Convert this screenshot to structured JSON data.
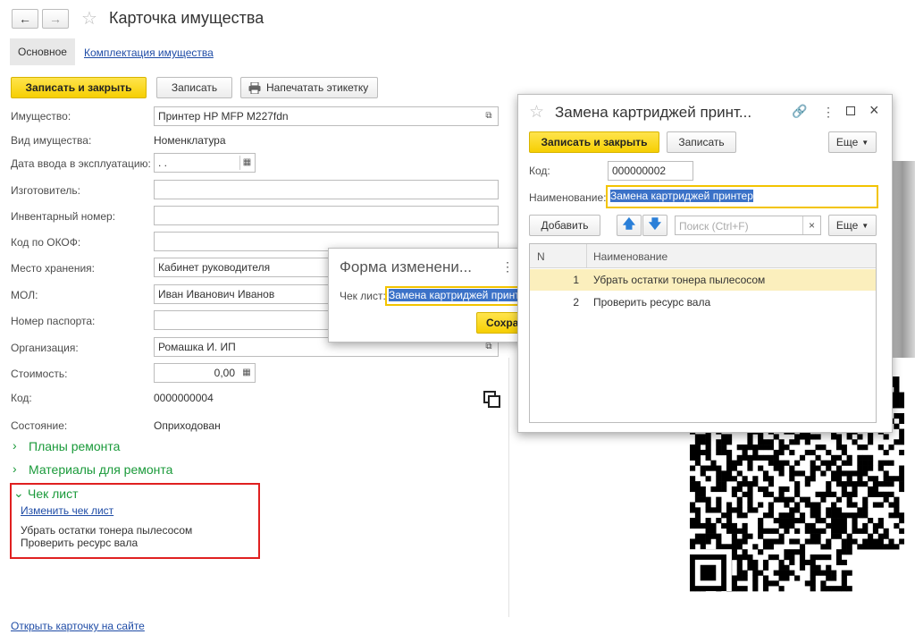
{
  "main": {
    "title": "Карточка имущества",
    "tabs": [
      {
        "label": "Основное"
      },
      {
        "label": "Комплектация имущества"
      }
    ],
    "toolbar": {
      "save_close": "Записать и закрыть",
      "save": "Записать",
      "print_label": "Напечатать этикетку"
    },
    "fields": {
      "property_label": "Имущество:",
      "property_value": "Принтер HP MFP M227fdn",
      "type_label": "Вид имущества:",
      "type_value": "Номенклатура",
      "date_label": "Дата ввода в эксплуатацию:",
      "date_value": " .  .",
      "manufacturer_label": "Изготовитель:",
      "manufacturer_value": "",
      "inventory_label": "Инвентарный номер:",
      "inventory_value": "",
      "okof_label": "Код по ОКОФ:",
      "okof_value": "",
      "storage_label": "Место хранения:",
      "storage_value": "Кабинет руководителя",
      "mol_label": "МОЛ:",
      "mol_value": "Иван Иванович Иванов",
      "passport_label": "Номер паспорта:",
      "passport_value": "",
      "org_label": "Организация:",
      "org_value": "Ромашка И. ИП",
      "cost_label": "Стоимость:",
      "cost_value": "0,00",
      "code_label": "Код:",
      "code_value": "0000000004",
      "state_label": "Состояние:",
      "state_value": "Оприходован"
    },
    "sections": {
      "repair_plans": "Планы ремонта",
      "repair_materials": "Материалы для ремонта",
      "checklist": "Чек лист",
      "change_checklist": "Изменить чек лист",
      "checklist_items": [
        "Убрать остатки тонера пылесосом",
        "Проверить ресурс вала"
      ]
    },
    "open_site": "Открыть карточку на сайте"
  },
  "change_form": {
    "title": "Форма изменени...",
    "checklist_label": "Чек лист:",
    "checklist_value": "Замена картриджей принтер",
    "save_button": "Сохра"
  },
  "dialog": {
    "title": "Замена картриджей принт...",
    "save_close": "Записать и закрыть",
    "save": "Записать",
    "more": "Еще",
    "code_label": "Код:",
    "code_value": "000000002",
    "name_label": "Наименование:",
    "name_value": "Замена картриджей принтер",
    "add_button": "Добавить",
    "search_placeholder": "Поиск (Ctrl+F)",
    "more2": "Еще",
    "table": {
      "headers": [
        "N",
        "Наименование"
      ],
      "rows": [
        {
          "n": "1",
          "name": "Убрать остатки тонера пылесосом"
        },
        {
          "n": "2",
          "name": "Проверить ресурс вала"
        }
      ]
    }
  },
  "colors": {
    "accent_yellow": "#f6cf02",
    "section_green": "#1a9a3a",
    "link_blue": "#1f4ca6",
    "highlight_red": "#e02020",
    "selected_row": "#fbefbd"
  },
  "icons": [
    "back-arrow-icon",
    "forward-arrow-icon",
    "star-icon",
    "printer-icon",
    "open-icon",
    "calendar-icon",
    "calculator-icon",
    "copy-icon",
    "chevron-right-icon",
    "chevron-down-icon",
    "more-vert-icon",
    "link-icon",
    "maximize-icon",
    "close-icon",
    "arrow-up-icon",
    "arrow-down-icon",
    "clear-icon",
    "qr-code"
  ]
}
